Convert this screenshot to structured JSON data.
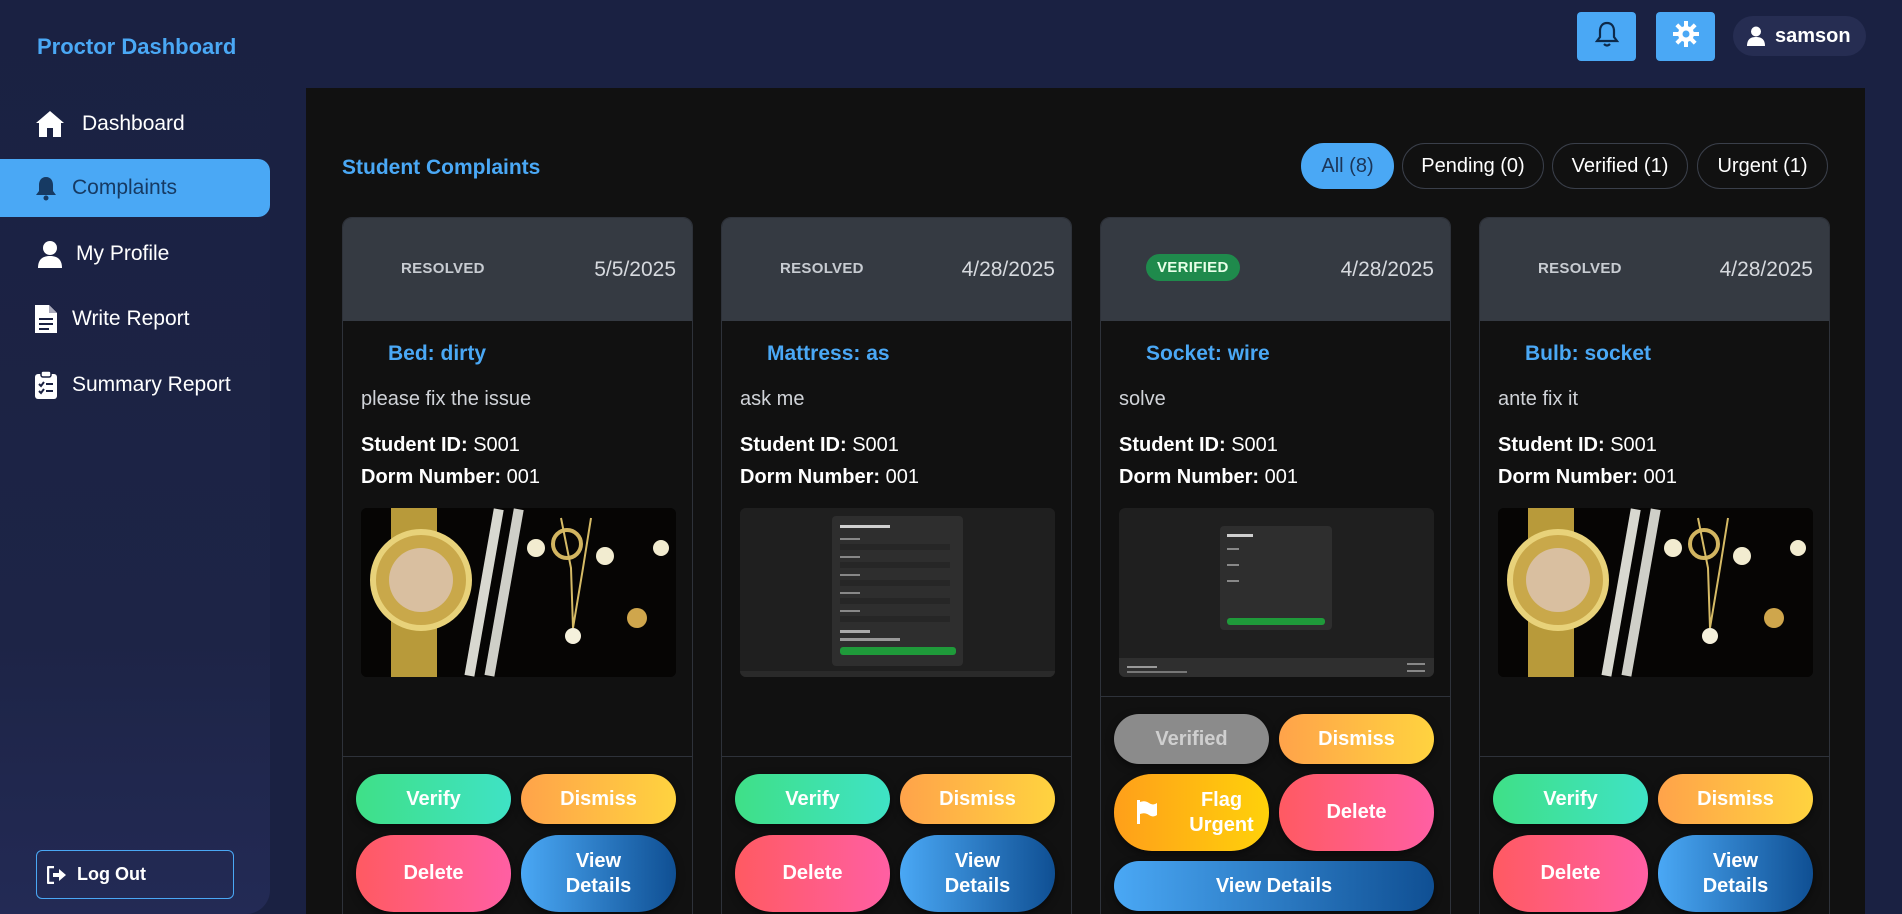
{
  "sidebar": {
    "brand": "Proctor Dashboard",
    "items": [
      {
        "label": "Dashboard",
        "icon": "home-icon"
      },
      {
        "label": "Complaints",
        "icon": "bell-icon"
      },
      {
        "label": "My Profile",
        "icon": "user-icon"
      },
      {
        "label": "Write Report",
        "icon": "document-icon"
      },
      {
        "label": "Summary Report",
        "icon": "clipboard-icon"
      }
    ],
    "logout_label": "Log Out"
  },
  "header": {
    "notification_icon": "bell-icon",
    "settings_icon": "gear-icon",
    "username": "samson"
  },
  "main": {
    "title": "Student Complaints",
    "filters": [
      {
        "label": "All (8)"
      },
      {
        "label": "Pending (0)"
      },
      {
        "label": "Verified (1)"
      },
      {
        "label": "Urgent (1)"
      }
    ]
  },
  "cards": [
    {
      "status": "RESOLVED",
      "date": "5/5/2025",
      "title": "Bed: dirty",
      "description": "please fix the issue",
      "student_id_label": "Student ID:",
      "student_id": " S001",
      "dorm_label": "Dorm Number:",
      "dorm": " 001",
      "image": "jewelry-photo",
      "actions": {
        "verify": "Verify",
        "dismiss": "Dismiss",
        "delete": "Delete",
        "view": "View Details"
      }
    },
    {
      "status": "RESOLVED",
      "date": "4/28/2025",
      "title": "Mattress: as",
      "description": "ask me",
      "student_id_label": "Student ID:",
      "student_id": " S001",
      "dorm_label": "Dorm Number:",
      "dorm": " 001",
      "image": "form-screenshot",
      "actions": {
        "verify": "Verify",
        "dismiss": "Dismiss",
        "delete": "Delete",
        "view": "View Details"
      }
    },
    {
      "status": "VERIFIED",
      "date": "4/28/2025",
      "title": "Socket: wire",
      "description": "solve",
      "student_id_label": "Student ID:",
      "student_id": " S001",
      "dorm_label": "Dorm Number:",
      "dorm": " 001",
      "image": "form-screenshot",
      "actions": {
        "verified": "Verified",
        "dismiss": "Dismiss",
        "flag": "Flag Urgent",
        "delete": "Delete",
        "view": "View Details"
      }
    },
    {
      "status": "RESOLVED",
      "date": "4/28/2025",
      "title": "Bulb: socket",
      "description": "ante fix it",
      "student_id_label": "Student ID:",
      "student_id": " S001",
      "dorm_label": "Dorm Number:",
      "dorm": " 001",
      "image": "jewelry-photo",
      "actions": {
        "verify": "Verify",
        "dismiss": "Dismiss",
        "delete": "Delete",
        "view": "View Details"
      }
    }
  ],
  "colors": {
    "accent": "#4aa8f5",
    "sidebar_bg": "#1a2142",
    "panel_bg": "#111111",
    "verified_badge": "#1f8a4c"
  }
}
